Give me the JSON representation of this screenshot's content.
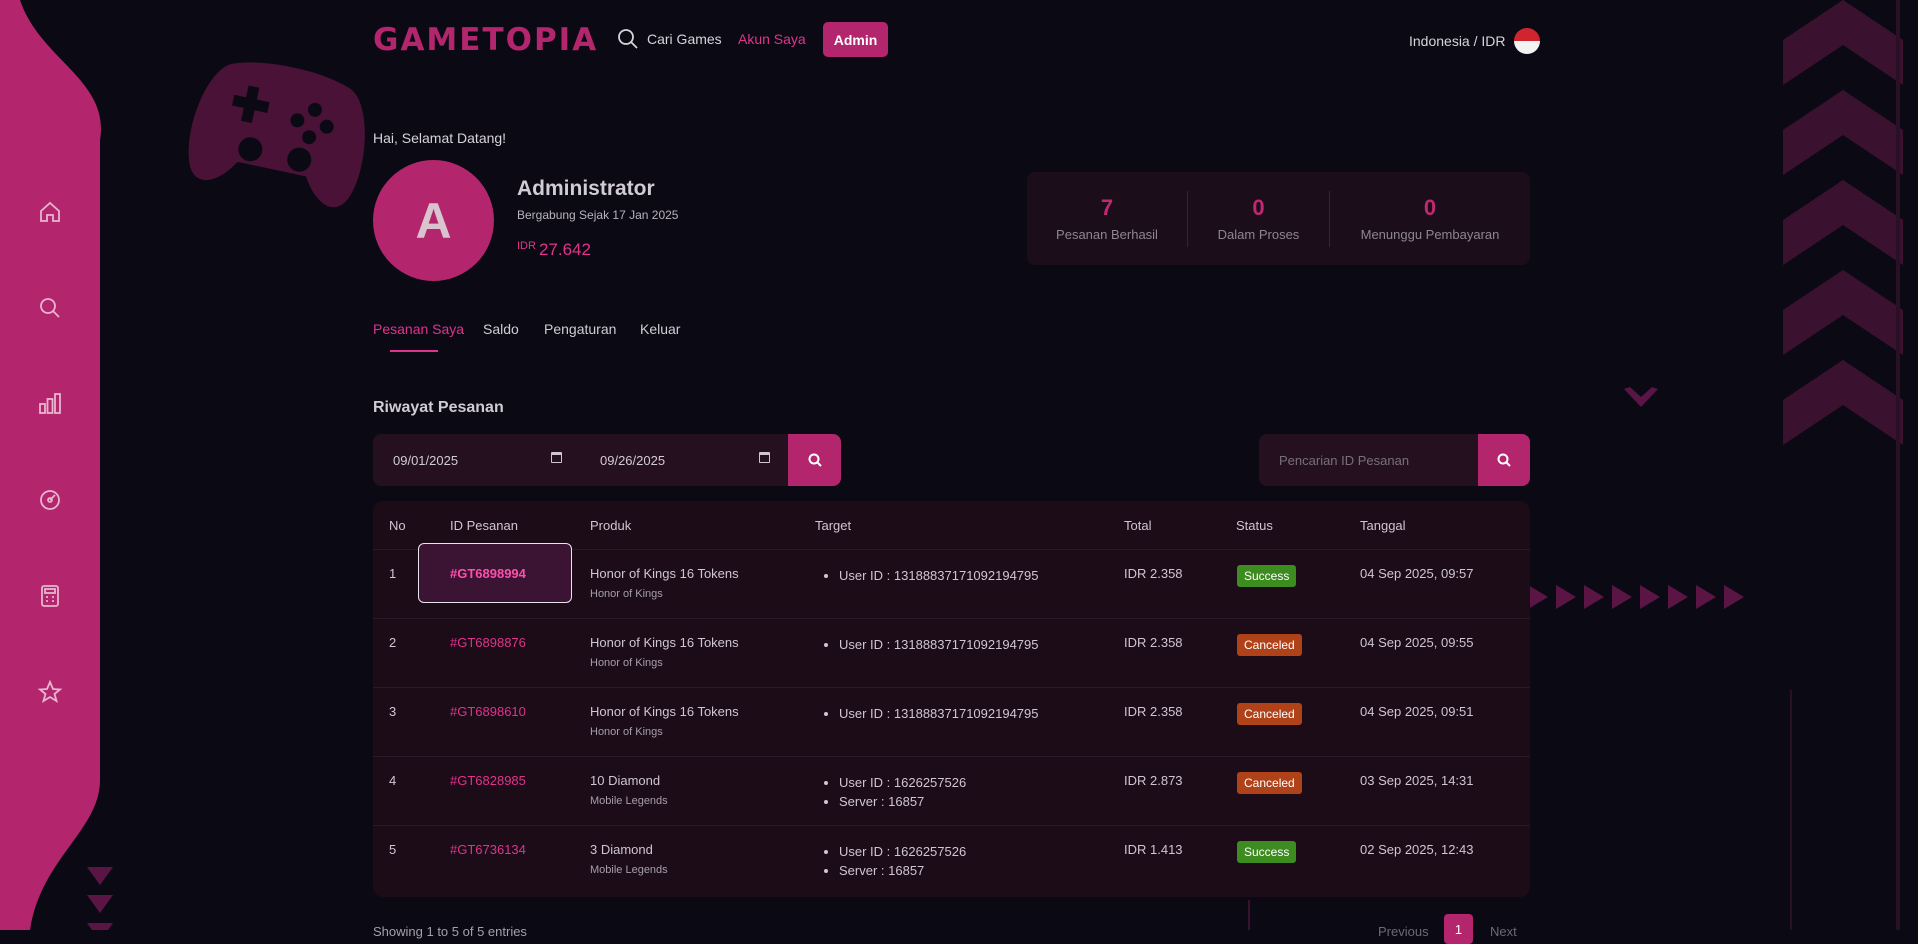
{
  "header": {
    "logo": "GAMETOPIA",
    "search_label": "Cari Games",
    "account_label": "Akun Saya",
    "admin_label": "Admin",
    "locale_label": "Indonesia / IDR"
  },
  "sidebar": {
    "icons": [
      "home-icon",
      "search-icon",
      "chart-icon",
      "dashboard-icon",
      "calculator-icon",
      "star-icon"
    ]
  },
  "profile": {
    "greeting": "Hai, Selamat Datang!",
    "avatar_letter": "A",
    "name": "Administrator",
    "joined": "Bergabung Sejak 17 Jan 2025",
    "balance_currency": "IDR",
    "balance_amount": "27.642"
  },
  "stats": [
    {
      "value": "7",
      "label": "Pesanan Berhasil"
    },
    {
      "value": "0",
      "label": "Dalam Proses"
    },
    {
      "value": "0",
      "label": "Menunggu Pembayaran"
    }
  ],
  "tabs": [
    "Pesanan Saya",
    "Saldo",
    "Pengaturan",
    "Keluar"
  ],
  "section_title": "Riwayat Pesanan",
  "filters": {
    "date_from": "09/01/2025",
    "date_to": "09/26/2025",
    "search_placeholder": "Pencarian ID Pesanan"
  },
  "table": {
    "headers": [
      "No",
      "ID Pesanan",
      "Produk",
      "Target",
      "Total",
      "Status",
      "Tanggal"
    ],
    "rows": [
      {
        "no": "1",
        "id": "#GT6898994",
        "product": "Honor of Kings 16 Tokens",
        "game": "Honor of Kings",
        "target_1": "User ID : 13188837171092194795",
        "target_2": "",
        "total": "IDR 2.358",
        "status": "Success",
        "date": "04 Sep 2025, 09:57"
      },
      {
        "no": "2",
        "id": "#GT6898876",
        "product": "Honor of Kings 16 Tokens",
        "game": "Honor of Kings",
        "target_1": "User ID : 13188837171092194795",
        "target_2": "",
        "total": "IDR 2.358",
        "status": "Canceled",
        "date": "04 Sep 2025, 09:55"
      },
      {
        "no": "3",
        "id": "#GT6898610",
        "product": "Honor of Kings 16 Tokens",
        "game": "Honor of Kings",
        "target_1": "User ID : 13188837171092194795",
        "target_2": "",
        "total": "IDR 2.358",
        "status": "Canceled",
        "date": "04 Sep 2025, 09:51"
      },
      {
        "no": "4",
        "id": "#GT6828985",
        "product": "10 Diamond",
        "game": "Mobile Legends",
        "target_1": "User ID : 1626257526",
        "target_2": "Server : 16857",
        "total": "IDR 2.873",
        "status": "Canceled",
        "date": "03 Sep 2025, 14:31"
      },
      {
        "no": "5",
        "id": "#GT6736134",
        "product": "3 Diamond",
        "game": "Mobile Legends",
        "target_1": "User ID : 1626257526",
        "target_2": "Server : 16857",
        "total": "IDR 1.413",
        "status": "Success",
        "date": "02 Sep 2025, 12:43"
      }
    ]
  },
  "pagination": {
    "info": "Showing 1 to 5 of 5 entries",
    "previous": "Previous",
    "page": "1",
    "next": "Next"
  },
  "colors": {
    "accent": "#b3266e",
    "link": "#e0338d",
    "background": "#0b0a14",
    "success": "#3d8c1f",
    "canceled": "#b0421a"
  }
}
